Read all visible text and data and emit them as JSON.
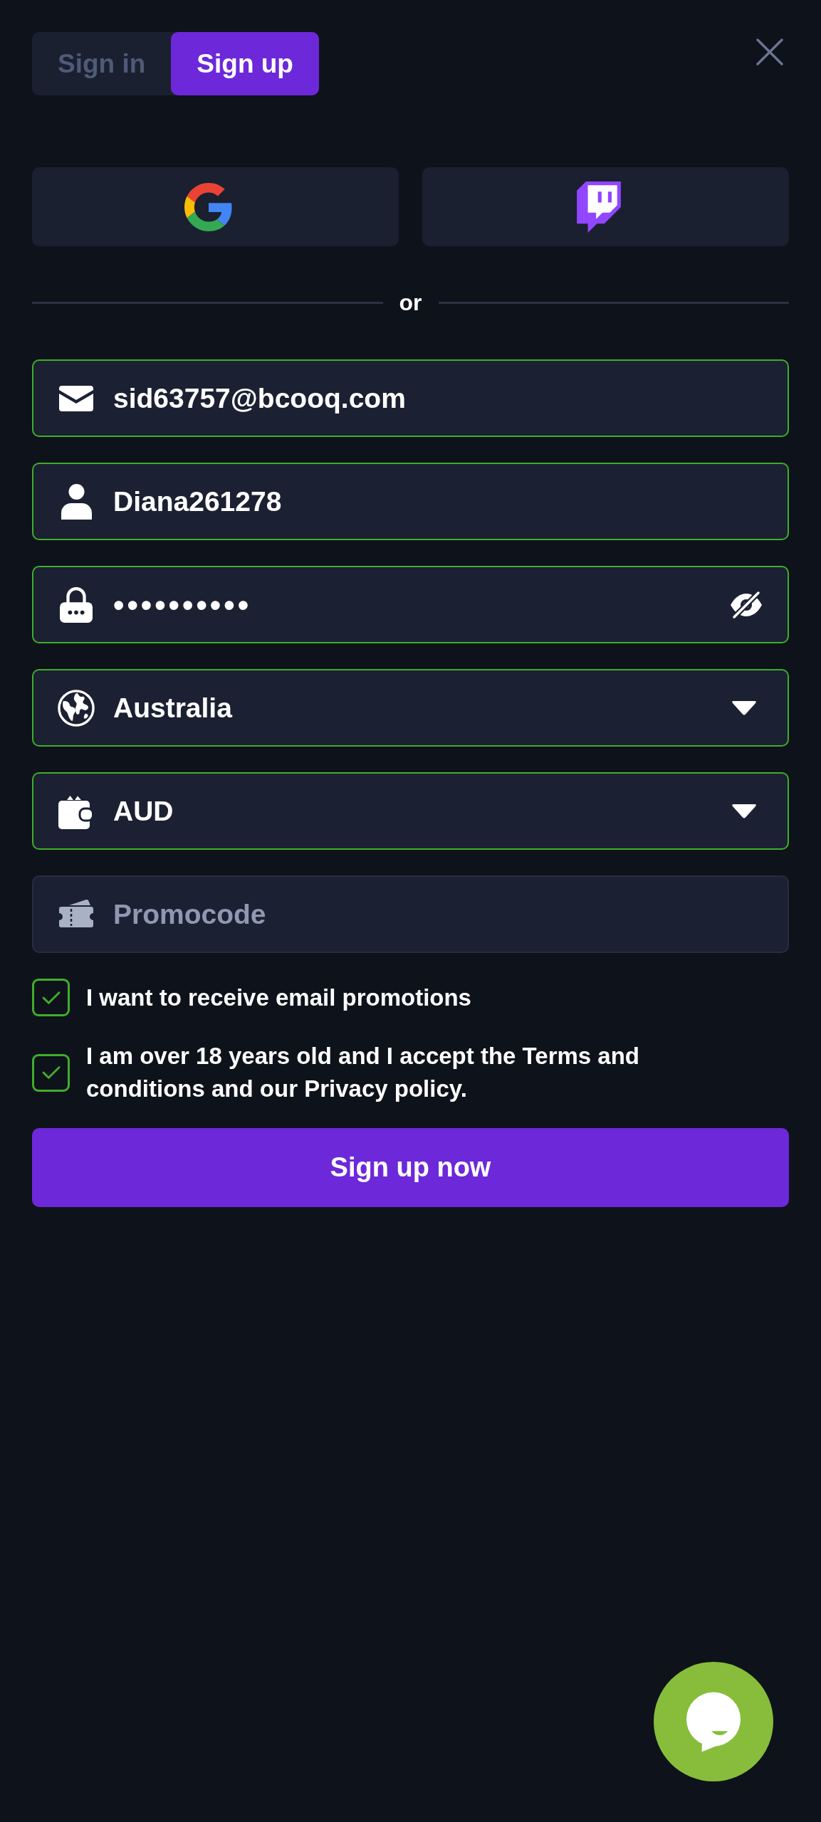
{
  "tabs": [
    {
      "label": "Sign in",
      "selected": false
    },
    {
      "label": "Sign up",
      "selected": true
    }
  ],
  "divider": {
    "label": "or"
  },
  "fields": [
    {
      "kind": "text",
      "value": "sid63757@bcooq.com",
      "valid": true
    },
    {
      "kind": "text",
      "value": "Diana261278",
      "valid": true
    },
    {
      "kind": "password",
      "value": "••••••••••",
      "valid": true
    },
    {
      "kind": "select",
      "value": "Australia",
      "valid": true
    },
    {
      "kind": "select",
      "value": "AUD",
      "valid": true
    },
    {
      "kind": "text",
      "placeholder": "Promocode",
      "valid": false
    }
  ],
  "checkboxes": [
    {
      "label": "I want to receive email promotions",
      "checked": true
    },
    {
      "label": "I am over 18 years old and I accept the Terms and conditions and our Privacy policy.",
      "checked": true
    }
  ],
  "submit_button": {
    "label": "Sign up now"
  }
}
